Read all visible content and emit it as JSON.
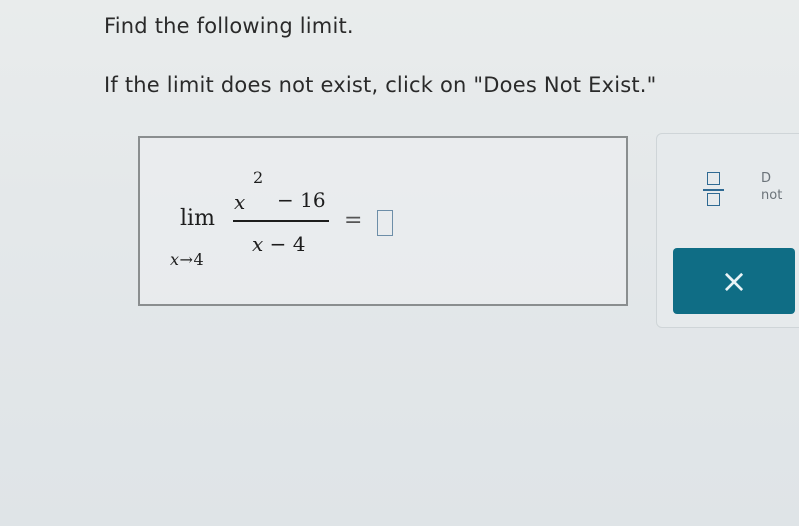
{
  "instructions": {
    "line1": "Find the following limit.",
    "line2": "If the limit does not exist, click on \"Does Not Exist.\""
  },
  "problem": {
    "lim": "lim",
    "lim_var": "x",
    "lim_arrow": "→",
    "lim_target": "4",
    "num_var": "x",
    "num_exponent": "2",
    "num_rest": "− 16",
    "den_var": "x",
    "den_op": "−",
    "den_num": "4",
    "equals": "=",
    "answer_value": ""
  },
  "toolbar": {
    "dne_label": "D\nnot",
    "clear_symbol": "×"
  },
  "colors": {
    "accent": "#0f6d85",
    "input_border": "#6d8ea8",
    "icon": "#2f6a93"
  }
}
